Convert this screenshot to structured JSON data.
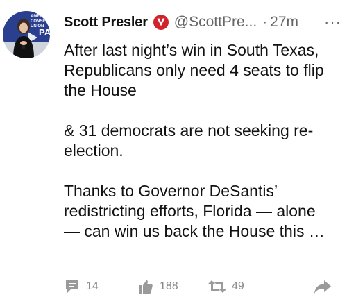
{
  "tweet": {
    "author_name": "Scott Presler",
    "handle": "@ScottPre...",
    "separator": "·",
    "time": "27m",
    "more_label": "···",
    "avatar_sign_lines": [
      "AMER",
      "CONSE",
      "UNION"
    ],
    "avatar_sign_logo": "PA",
    "text": {
      "p1": [
        "After last night’s win in South Texas,",
        "Republicans only need 4 seats to flip",
        "the House"
      ],
      "p2": [
        "& 31 democrats are not seeking re-",
        "election."
      ],
      "p3": [
        "Thanks to Governor DeSantis’",
        "redistricting efforts, Florida — alone",
        "— can win us back the House this …"
      ]
    },
    "actions": {
      "reply_count": "14",
      "like_count": "188",
      "retweet_count": "49"
    }
  },
  "colors": {
    "verified": "#d0232b",
    "secondary": "#666666",
    "action_icon": "#999999"
  },
  "icons": [
    "verified-badge-icon",
    "more-icon",
    "reply-icon",
    "like-icon",
    "retweet-icon",
    "share-icon"
  ]
}
